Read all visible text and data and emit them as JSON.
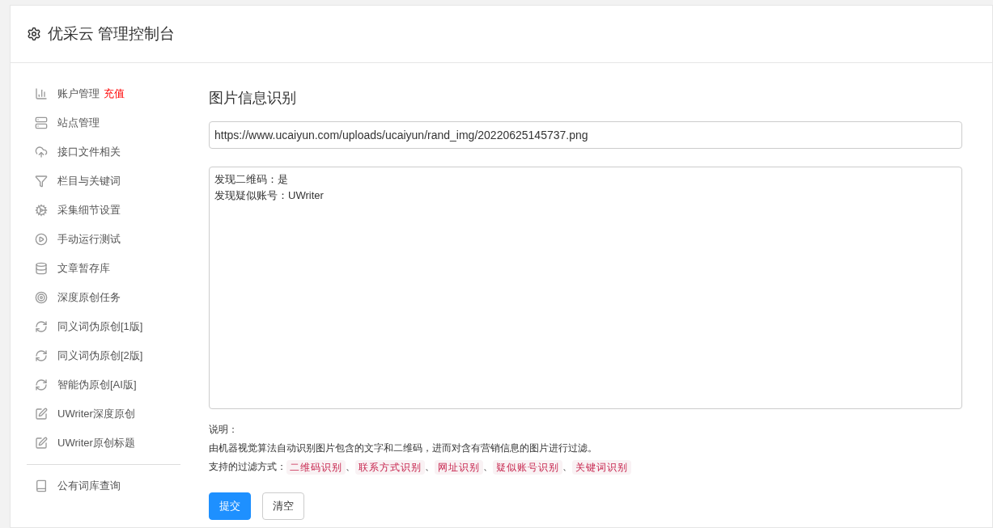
{
  "header": {
    "title": "优采云 管理控制台"
  },
  "sidebar": {
    "groups": [
      {
        "items": [
          {
            "label": "账户管理",
            "badge": "充值"
          },
          {
            "label": "站点管理"
          },
          {
            "label": "接口文件相关"
          },
          {
            "label": "栏目与关键词"
          },
          {
            "label": "采集细节设置"
          },
          {
            "label": "手动运行测试"
          },
          {
            "label": "文章暂存库"
          },
          {
            "label": "深度原创任务"
          },
          {
            "label": "同义词伪原创[1版]"
          },
          {
            "label": "同义词伪原创[2版]"
          },
          {
            "label": "智能伪原创[AI版]"
          },
          {
            "label": "UWriter深度原创"
          },
          {
            "label": "UWriter原创标题"
          }
        ]
      },
      {
        "items": [
          {
            "label": "公有词库查询"
          }
        ]
      }
    ]
  },
  "main": {
    "heading": "图片信息识别",
    "url_field": {
      "value": "https://www.ucaiyun.com/uploads/ucaiyun/rand_img/20220625145737.png"
    },
    "result_box": {
      "lines": [
        "发现二维码：是",
        "发现疑似账号：UWriter"
      ]
    },
    "notes": {
      "title": "说明：",
      "description": "由机器视觉算法自动识别图片包含的文字和二维码，进而对含有营销信息的图片进行过滤。",
      "methods_label": "支持的过滤方式：",
      "separator": "、",
      "methods": [
        "二维码识别",
        "联系方式识别",
        "网址识别",
        "疑似账号识别",
        "关键词识别"
      ]
    },
    "buttons": [
      {
        "label": "提交",
        "kind": "primary"
      },
      {
        "label": "清空",
        "kind": "default"
      }
    ]
  }
}
